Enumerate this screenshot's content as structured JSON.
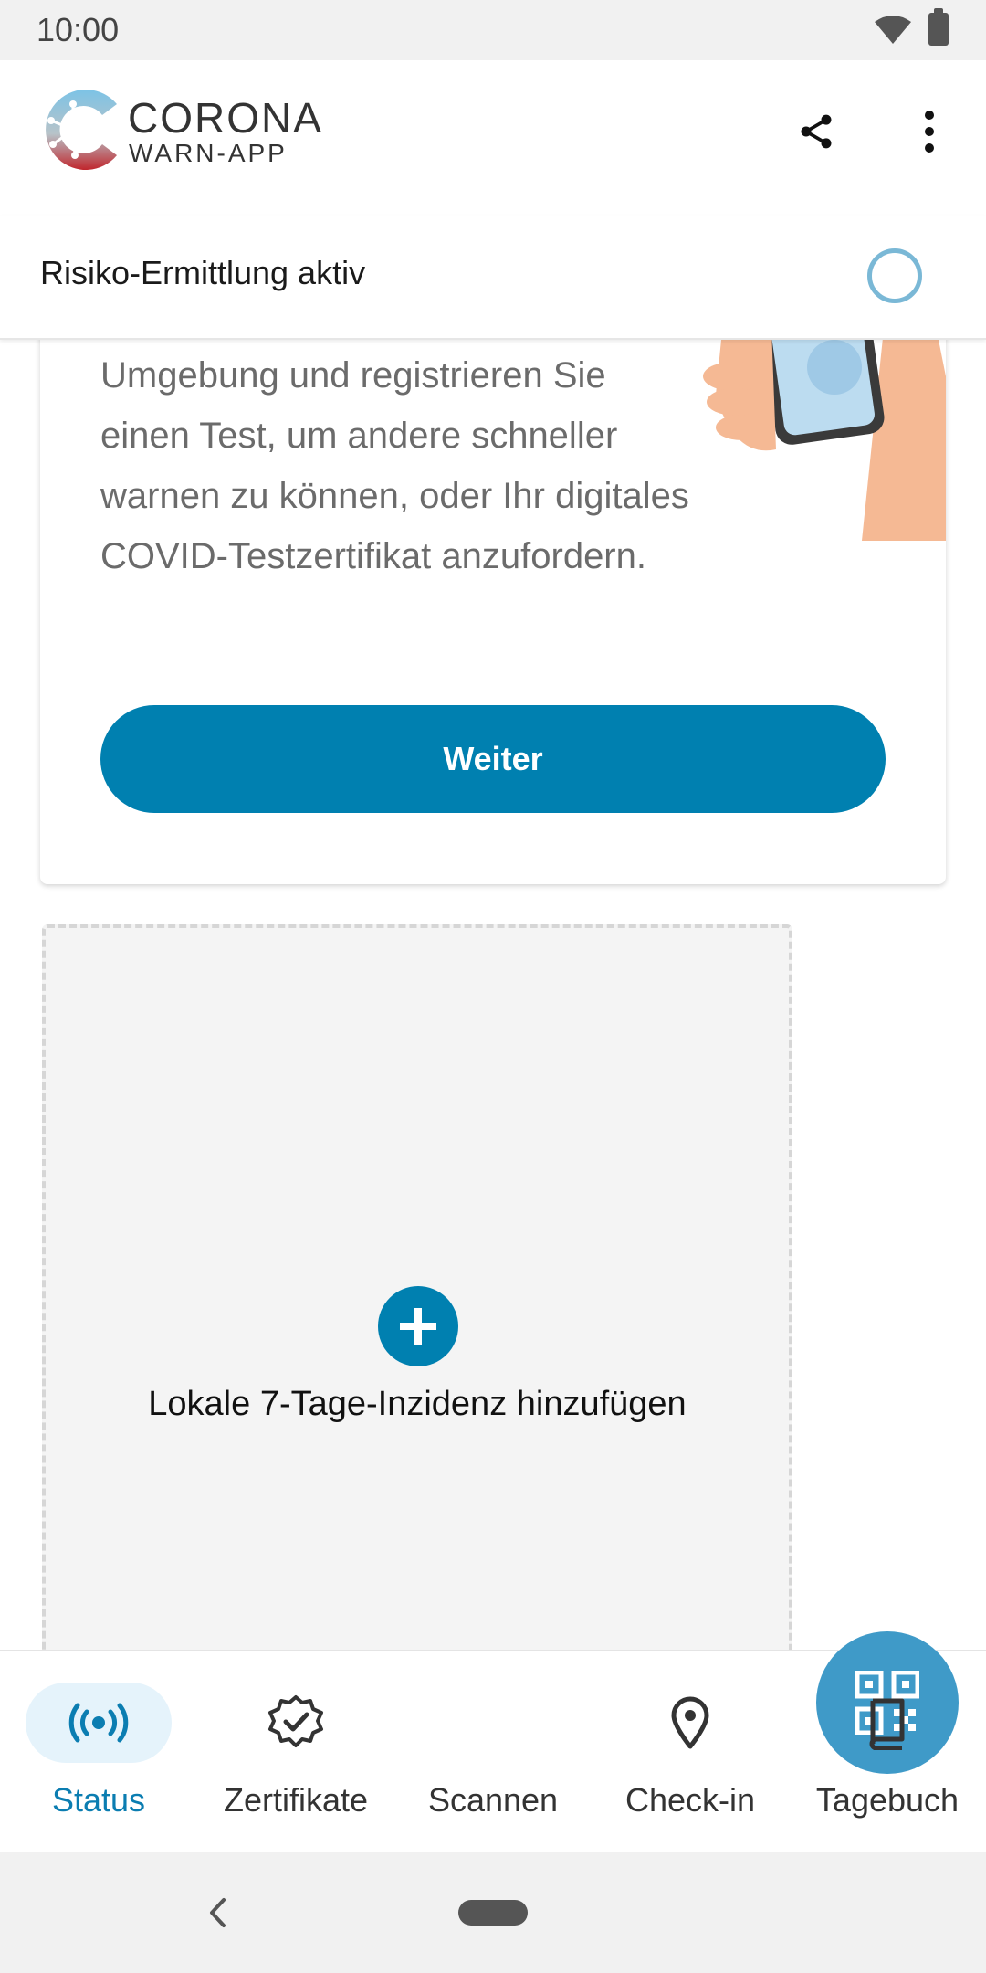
{
  "status_bar": {
    "time": "10:00"
  },
  "app_header": {
    "brand_line1": "CORONA",
    "brand_line2": "WARN-APP",
    "share_icon": "share-icon",
    "more_icon": "more-vert-icon"
  },
  "risk": {
    "label": "Risiko-Ermittlung aktiv",
    "accent": "#7ab8d6"
  },
  "test_card": {
    "text": "Finden Sie Teststellen in Ihrer Umgebung und registrieren Sie einen Test, um andere schneller warnen zu können, oder Ihr digitales COVID-Testzertifikat anzufordern.",
    "button_label": "Weiter",
    "button_color": "#0080b0"
  },
  "incidence_tile": {
    "label": "Lokale 7-Tage-Inzidenz hinzufügen"
  },
  "bottom_nav": {
    "items": [
      {
        "label": "Status",
        "icon": "radar-icon",
        "active": true
      },
      {
        "label": "Zertifikate",
        "icon": "badge-check-icon",
        "active": false
      },
      {
        "label": "Scannen",
        "icon": "qr-code-icon",
        "active": false
      },
      {
        "label": "Check-in",
        "icon": "location-pin-icon",
        "active": false
      },
      {
        "label": "Tagebuch",
        "icon": "book-icon",
        "active": false
      }
    ],
    "active_color": "#0b7db1"
  }
}
